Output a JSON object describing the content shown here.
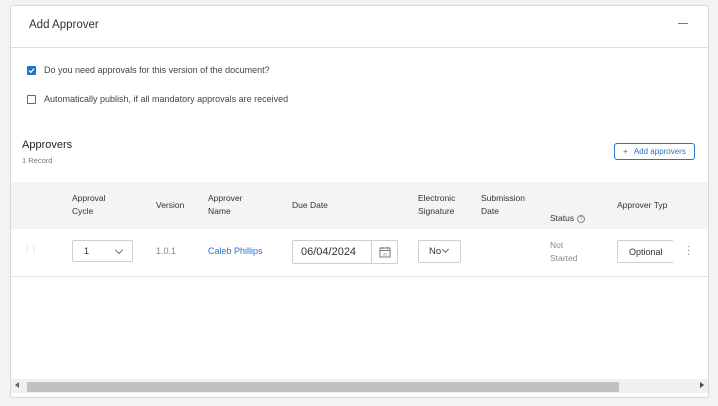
{
  "panel": {
    "title": "Add Approver",
    "collapse_icon": "minus-icon"
  },
  "options": {
    "need_approvals": {
      "label": "Do you need approvals for this version of the document?",
      "checked": true
    },
    "auto_publish": {
      "label": "Automatically publish, if all mandatory approvals are received",
      "checked": false
    }
  },
  "approvers": {
    "title": "Approvers",
    "count": "1 Record",
    "add_button": "Add approvers",
    "add_icon": "plus-icon"
  },
  "table": {
    "headers": {
      "approval_cycle": "Approval\nCycle",
      "version": "Version",
      "approver_name": "Approver\nName",
      "due_date": "Due Date",
      "electronic_signature": "Electronic\nSignature",
      "submission_date": "Submission\nDate",
      "status": "Status",
      "approver_type": "Approver Typ"
    },
    "rows": [
      {
        "approval_cycle": "1",
        "version": "1.0.1",
        "approver_name": "Caleb Phillips",
        "due_date": "06/04/2024",
        "electronic_signature": "No",
        "submission_date": "",
        "status": "Not\nStarted",
        "approver_type": "Optional"
      }
    ]
  },
  "colors": {
    "accent": "#1e74c8",
    "link": "#2a73c5",
    "header_bg": "#f4f4f4"
  }
}
